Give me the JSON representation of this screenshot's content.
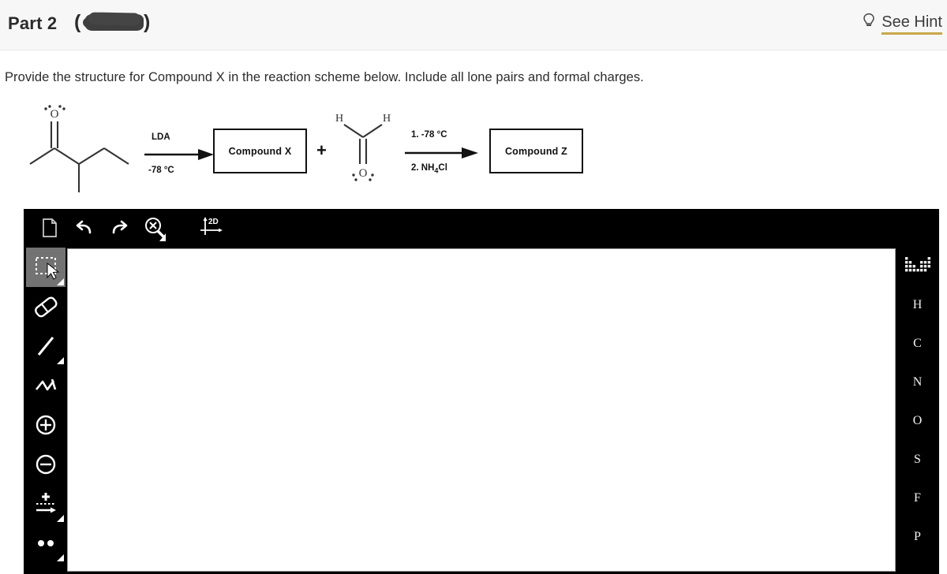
{
  "header": {
    "part_title": "Part 2",
    "paren_open": "(",
    "paren_close": ")",
    "redacted_note": "redacted-black-scribble",
    "hint_label": "See Hint",
    "hint_icon": "lightbulb-icon",
    "hint_underline_color": "#c8a84b",
    "bg_color": "#f7f7f7"
  },
  "prompt": {
    "text": "Provide the structure for Compound X in the reaction scheme below.  Include all lone pairs and formal charges."
  },
  "scheme": {
    "starting_material": {
      "name": "3-methylpentan-2-one",
      "oxygen_label": "O",
      "lone_pair_dots": 4
    },
    "arrow1": {
      "above_label": "LDA",
      "below_label": "-78 °C"
    },
    "box_x": {
      "label": "Compound X"
    },
    "plus": "+",
    "aldehyde": {
      "name": "formaldehyde",
      "h_left": "H",
      "h_right": "H",
      "oxygen_label": "O",
      "lone_pair_dots": 4
    },
    "arrow2": {
      "above_label": "1. -78 °C",
      "below_label_parts": {
        "pre": "2. NH",
        "sub": "4",
        "post": "Cl"
      },
      "below_label": "2. NH4Cl"
    },
    "box_z": {
      "label": "Compound Z"
    }
  },
  "editor": {
    "top_tools": [
      {
        "name": "new-document-icon",
        "title": "New"
      },
      {
        "name": "undo-icon",
        "title": "Undo"
      },
      {
        "name": "redo-icon",
        "title": "Redo"
      },
      {
        "name": "clear-zoom-icon",
        "title": "Erase / Zoom"
      },
      {
        "name": "2d-axes-icon",
        "title": "2D",
        "label": "2D"
      }
    ],
    "left_tools": [
      {
        "name": "select-tool",
        "title": "Select",
        "active": true,
        "has_menu": true
      },
      {
        "name": "eraser-tool",
        "title": "Eraser",
        "active": false,
        "has_menu": false
      },
      {
        "name": "single-bond-tool",
        "title": "Single bond",
        "active": false,
        "has_menu": true
      },
      {
        "name": "chain-tool",
        "title": "Chain",
        "active": false,
        "has_menu": false
      },
      {
        "name": "increase-charge-tool",
        "title": "Increase charge",
        "active": false,
        "has_menu": false
      },
      {
        "name": "decrease-charge-tool",
        "title": "Decrease charge",
        "active": false,
        "has_menu": false
      },
      {
        "name": "reaction-arrow-tool",
        "title": "Reaction arrow",
        "active": false,
        "has_menu": true
      },
      {
        "name": "lone-pair-tool",
        "title": "Lone pair",
        "active": false,
        "has_menu": true
      }
    ],
    "periodic_table_icon": "periodic-table-icon",
    "elements": [
      "H",
      "C",
      "N",
      "O",
      "S",
      "F",
      "P"
    ],
    "canvas_background": "#ffffff"
  }
}
